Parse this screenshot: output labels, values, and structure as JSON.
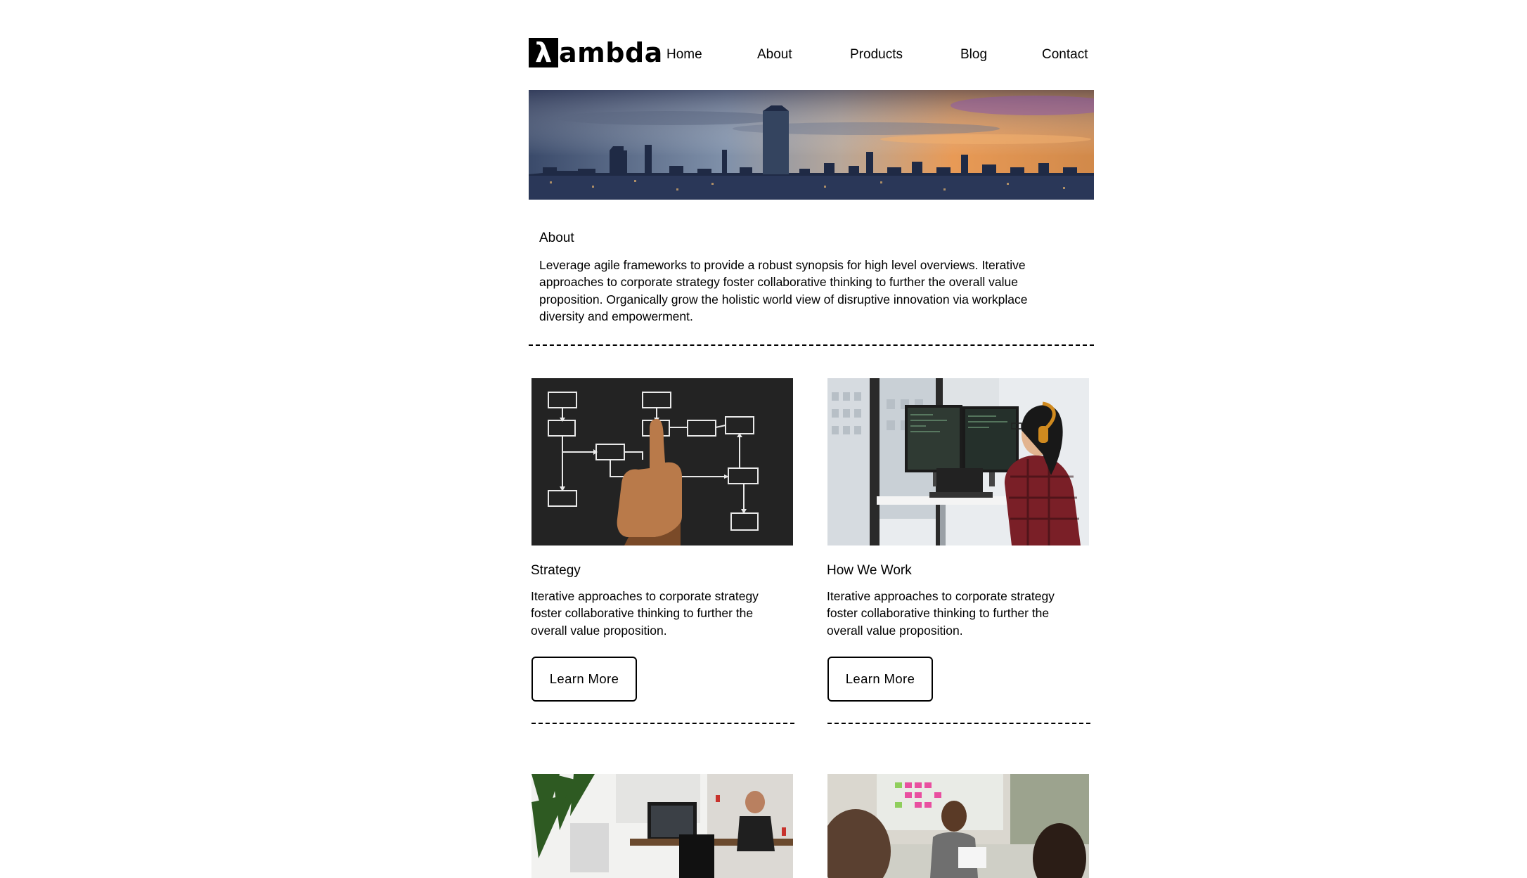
{
  "brand": {
    "logo_mark": "λ",
    "logo_text": "ambda"
  },
  "nav": {
    "items": [
      "Home",
      "About",
      "Products",
      "Blog",
      "Contact"
    ]
  },
  "about": {
    "title": "About",
    "text": "Leverage agile frameworks to provide a robust synopsis for high level overviews. Iterative approaches to corporate strategy foster collaborative thinking to further the overall value proposition. Organically grow the holistic world view of disruptive innovation via workplace diversity and empowerment."
  },
  "cards": [
    {
      "title": "Strategy",
      "text": "Iterative approaches to corporate strategy foster collaborative thinking to further the overall value proposition.",
      "button": "Learn More"
    },
    {
      "title": "How We Work",
      "text": "Iterative approaches to corporate strategy foster collaborative thinking to further the overall value proposition.",
      "button": "Learn More"
    }
  ],
  "colors": {
    "text": "#000000",
    "background": "#ffffff",
    "chalkboard": "#232323"
  }
}
